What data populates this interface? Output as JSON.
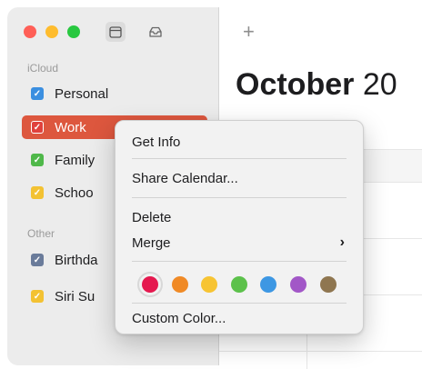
{
  "sidebar": {
    "toolbar": {
      "calendar_icon": "calendar-icon",
      "inbox_icon": "inbox-icon"
    },
    "sections": [
      {
        "label": "iCloud",
        "items": [
          {
            "label": "Personal",
            "color": "#3b8fe0",
            "checked": true
          },
          {
            "label": "Work",
            "color": "#e0413c",
            "checked": true,
            "selected": true
          },
          {
            "label": "Family",
            "color": "#4fb84a",
            "checked": true
          },
          {
            "label": "Schoo",
            "color": "#f3c233",
            "checked": true
          }
        ]
      },
      {
        "label": "Other",
        "items": [
          {
            "label": "Birthda",
            "color": "#6a7b9a",
            "checked": true
          },
          {
            "label": "Siri Su",
            "color": "#f3c233",
            "checked": true
          }
        ]
      }
    ]
  },
  "main": {
    "add_label": "+",
    "title_month": "October",
    "title_year": "20"
  },
  "context_menu": {
    "items": [
      {
        "label": "Get Info"
      },
      {
        "label": "Share Calendar..."
      },
      {
        "label": "Delete"
      },
      {
        "label": "Merge",
        "submenu_icon": "chevron-right-icon",
        "chevron": "›"
      }
    ],
    "colors": [
      {
        "name": "red",
        "hex": "#e5194f",
        "selected": true
      },
      {
        "name": "orange",
        "hex": "#f08a26"
      },
      {
        "name": "yellow",
        "hex": "#f7c433"
      },
      {
        "name": "green",
        "hex": "#5cc14b"
      },
      {
        "name": "blue",
        "hex": "#3d97e3"
      },
      {
        "name": "purple",
        "hex": "#a257c7"
      },
      {
        "name": "brown",
        "hex": "#8f7650"
      }
    ],
    "custom_color_label": "Custom Color..."
  }
}
